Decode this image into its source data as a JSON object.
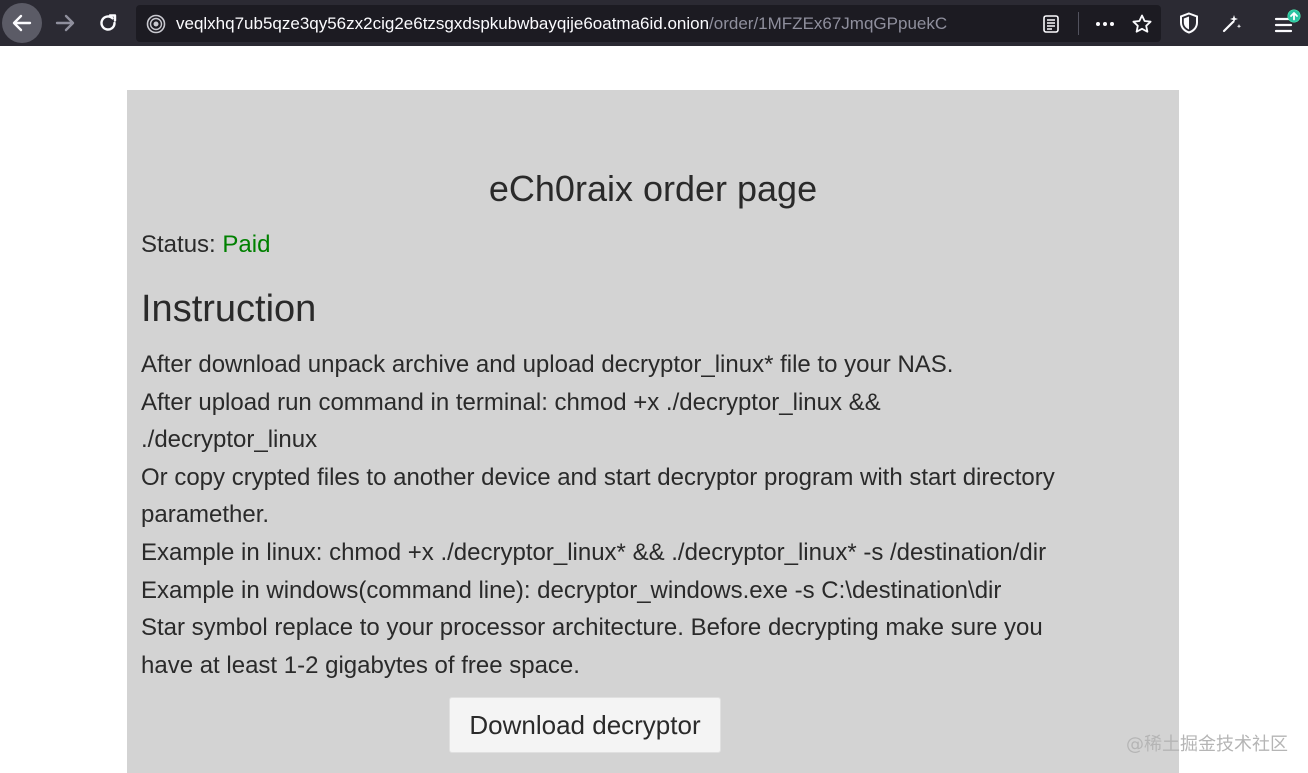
{
  "browser": {
    "url_host": "veqlxhq7ub5qze3qy56zx2cig2e6tzsgxdspkubwbayqije6oatma6id.onion",
    "url_path": "/order/1MFZEx67JmqGPpuekC",
    "icons": [
      "back-arrow-icon",
      "forward-arrow-icon",
      "reload-icon",
      "onion-site-icon",
      "reader-view-icon",
      "more-actions-icon",
      "bookmark-star-icon",
      "shield-icon",
      "customize-icon",
      "menu-update-icon"
    ]
  },
  "page": {
    "title": "eCh0raix order page",
    "status_label": "Status:",
    "status_value": "Paid",
    "status_color": "#008000",
    "instruction_heading": "Instruction",
    "instructions": [
      "After download unpack archive and upload decryptor_linux* file to your NAS.",
      "After upload run command in terminal: chmod +x ./decryptor_linux &&",
      "./decryptor_linux",
      "Or copy crypted files to another device and start decryptor program with start directory",
      "paramether.",
      "Example in linux: chmod +x ./decryptor_linux* && ./decryptor_linux* -s /destination/dir",
      "Example in windows(command line): decryptor_windows.exe -s C:\\destination\\dir",
      "Star symbol replace to your processor architecture. Before decrypting make sure you",
      "have at least 1-2 gigabytes of free space."
    ],
    "download_button": "Download decryptor"
  },
  "watermark": "@稀土掘金技术社区"
}
